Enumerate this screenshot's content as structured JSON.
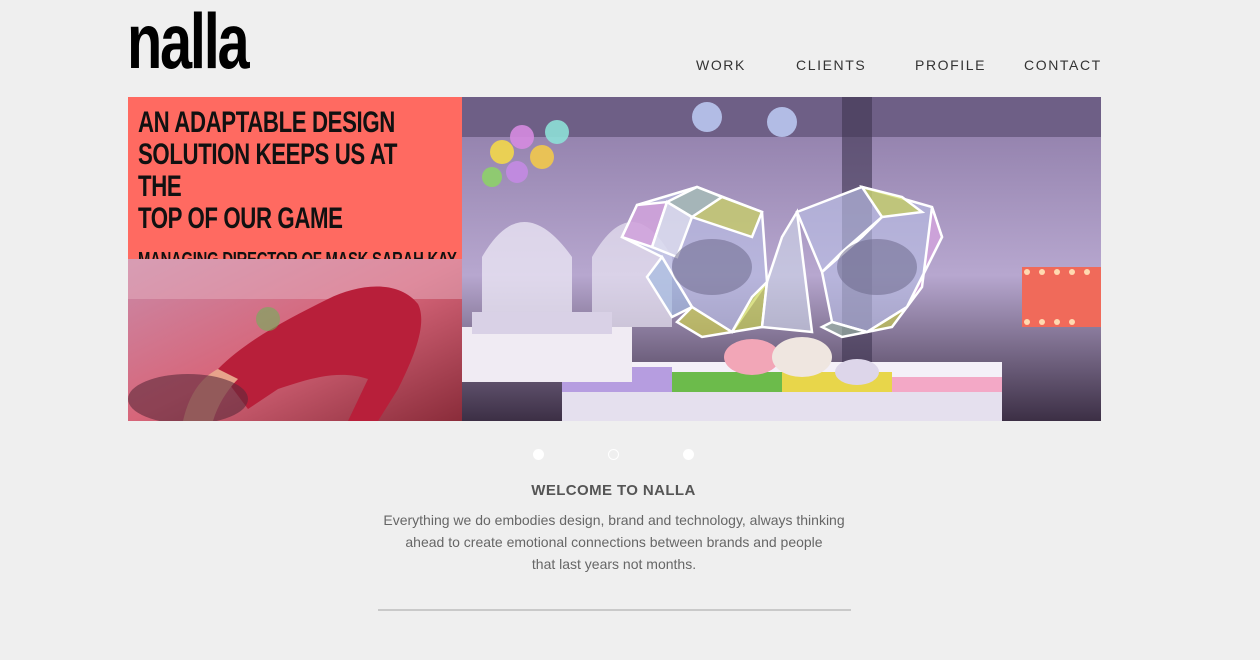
{
  "brand": {
    "logo_text": "nalla"
  },
  "nav": {
    "items": [
      "WORK",
      "CLIENTS",
      "PROFILE",
      "CONTACT"
    ]
  },
  "hero": {
    "quote_lines": [
      "AN ADAPTABLE DESIGN",
      "SOLUTION KEEPS US AT THE",
      "TOP OF OUR GAME"
    ],
    "attribution": "MANAGING DIRECTOR OF MASK SARAH KAY",
    "quote_bg_color": "#ff6a61"
  },
  "slider": {
    "dot_count": 3,
    "active_indices": [
      0,
      2
    ]
  },
  "welcome": {
    "heading": "WELCOME TO NALLA",
    "lines": [
      "Everything we do embodies design, brand and technology, always thinking",
      "ahead to create emotional connections between brands and people",
      "that last years not months."
    ]
  }
}
